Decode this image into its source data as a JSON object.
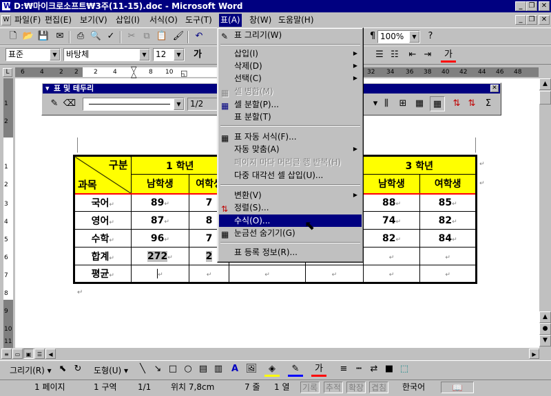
{
  "window": {
    "title": "D:₩마이크로소프트₩3주(11-15).doc - Microsoft Word"
  },
  "menubar": [
    "파일(F)",
    "편집(E)",
    "보기(V)",
    "삽입(I)",
    "서식(O)",
    "도구(T)",
    "표(A)",
    "창(W)",
    "도움말(H)"
  ],
  "toolbar": {
    "zoom": "100%"
  },
  "formatting": {
    "style": "표준",
    "font": "바탕체",
    "size": "12",
    "bold_label": "가"
  },
  "ruler": {
    "left_nums": [
      "6",
      "4",
      "2",
      "2"
    ],
    "nums": [
      "2",
      "4",
      "6",
      "8",
      "10",
      "12"
    ],
    "right_nums": [
      "32",
      "34",
      "36",
      "38",
      "40",
      "42",
      "44",
      "46",
      "48"
    ]
  },
  "vruler": [
    "1",
    "2",
    "1",
    "1",
    "2",
    "3",
    "4",
    "5",
    "6",
    "7",
    "8",
    "9",
    "10",
    "11"
  ],
  "tables_borders": {
    "title": "표 및 테두리",
    "line_weight": "1/2"
  },
  "table_menu": {
    "draw": "표 그리기(W)",
    "insert": "삽입(I)",
    "delete": "삭제(D)",
    "select": "선택(C)",
    "merge": "셀 병합(M)",
    "split": "셀 분할(P)...",
    "split_table": "표 분할(T)",
    "autoformat": "표 자동 서식(F)...",
    "autofit": "자동 맞춤(A)",
    "heading_rows": "페이지 마다 머리글 행 반복(H)",
    "diagonal": "다중 대각선 셀 삽입(U)...",
    "convert": "변환(V)",
    "sort": "정렬(S)...",
    "formula": "수식(O)...",
    "gridlines": "눈금선 숨기기(G)",
    "properties": "표 등록 정보(R)..."
  },
  "doc_table": {
    "corner_top": "구분",
    "corner_bottom": "과목",
    "grade1": "1 학년",
    "grade3": "3 학년",
    "male": "남학생",
    "female": "여학생",
    "rows": [
      {
        "subject": "국어",
        "v1": "89",
        "v2": "7",
        "v5": "88",
        "v6": "85"
      },
      {
        "subject": "영어",
        "v1": "87",
        "v2": "8",
        "v5": "74",
        "v6": "82"
      },
      {
        "subject": "수학",
        "v1": "96",
        "v2": "7",
        "v5": "82",
        "v6": "84"
      },
      {
        "subject": "합계",
        "v1": "272",
        "v2": "2",
        "v5": "",
        "v6": ""
      },
      {
        "subject": "평균",
        "v1": "",
        "v2": "",
        "v5": "",
        "v6": ""
      }
    ]
  },
  "drawbar": {
    "draw": "그리기(R)",
    "shapes": "도형(U)"
  },
  "status": {
    "page": "1 페이지",
    "section": "1 구역",
    "pages": "1/1",
    "pos": "위치 7,8cm",
    "line": "7 줄",
    "col": "1 열",
    "rec": "기록",
    "trk": "추적",
    "ext": "확장",
    "ovr": "겹침",
    "lang": "한국어"
  }
}
